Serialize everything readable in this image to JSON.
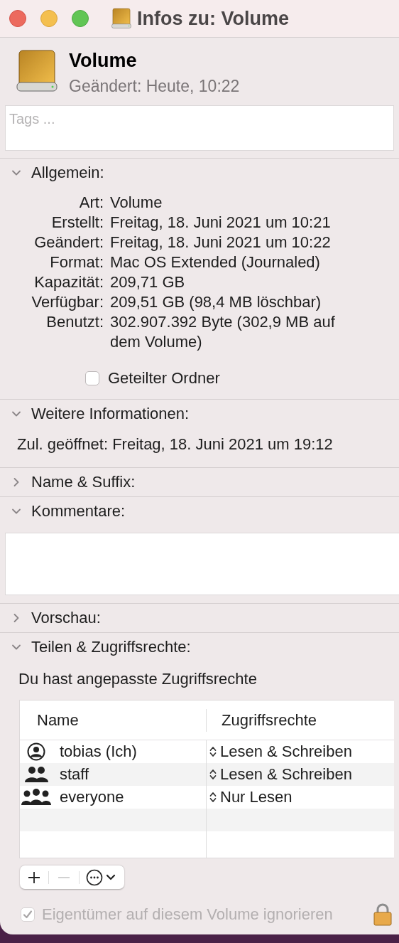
{
  "window": {
    "title": "Infos zu: Volume"
  },
  "header": {
    "name": "Volume",
    "modified": "Geändert: Heute, 10:22"
  },
  "tags_field": {
    "placeholder": "Tags ..."
  },
  "sections": [
    {
      "kind": "general",
      "title": "Allgemein:",
      "expanded": true,
      "rows": [
        {
          "label": "Art:",
          "value": "Volume"
        },
        {
          "label": "Erstellt:",
          "value": "Freitag, 18. Juni 2021 um 10:21"
        },
        {
          "label": "Geändert:",
          "value": "Freitag, 18. Juni 2021 um 10:22"
        },
        {
          "label": "Format:",
          "value": "Mac OS Extended (Journaled)"
        },
        {
          "label": "Kapazität:",
          "value": "209,71 GB"
        },
        {
          "label": "Verfügbar:",
          "value": "209,51 GB (98,4 MB löschbar)"
        },
        {
          "label": "Benutzt:",
          "value": "302.907.392 Byte (302,9 MB auf dem Volume)"
        }
      ],
      "shared_folder": {
        "label": "Geteilter Ordner",
        "checked": false
      }
    },
    {
      "kind": "info",
      "title": "Weitere Informationen:",
      "expanded": true,
      "rows": [
        {
          "label": "Zul. geöffnet:",
          "value": "Freitag, 18. Juni 2021 um 19:12"
        }
      ]
    },
    {
      "kind": "plain",
      "title": "Name & Suffix:",
      "expanded": false
    },
    {
      "kind": "comments",
      "title": "Kommentare:",
      "expanded": true
    },
    {
      "kind": "plain",
      "title": "Vorschau:",
      "expanded": false
    },
    {
      "kind": "sharing",
      "title": "Teilen & Zugriffsrechte:",
      "expanded": true,
      "note": "Du hast angepasste Zugriffsrechte",
      "columns": [
        "Name",
        "Zugriffsrechte"
      ],
      "rows": [
        {
          "kind": "user",
          "name": "tobias (Ich)",
          "privilege": "Lesen & Schreiben"
        },
        {
          "kind": "group",
          "name": "staff",
          "privilege": "Lesen & Schreiben"
        },
        {
          "kind": "everyone",
          "name": "everyone",
          "privilege": "Nur Lesen"
        }
      ],
      "ignore_owner": {
        "label": "Eigentümer auf diesem Volume ignorieren",
        "checked": true,
        "disabled": true
      }
    }
  ]
}
